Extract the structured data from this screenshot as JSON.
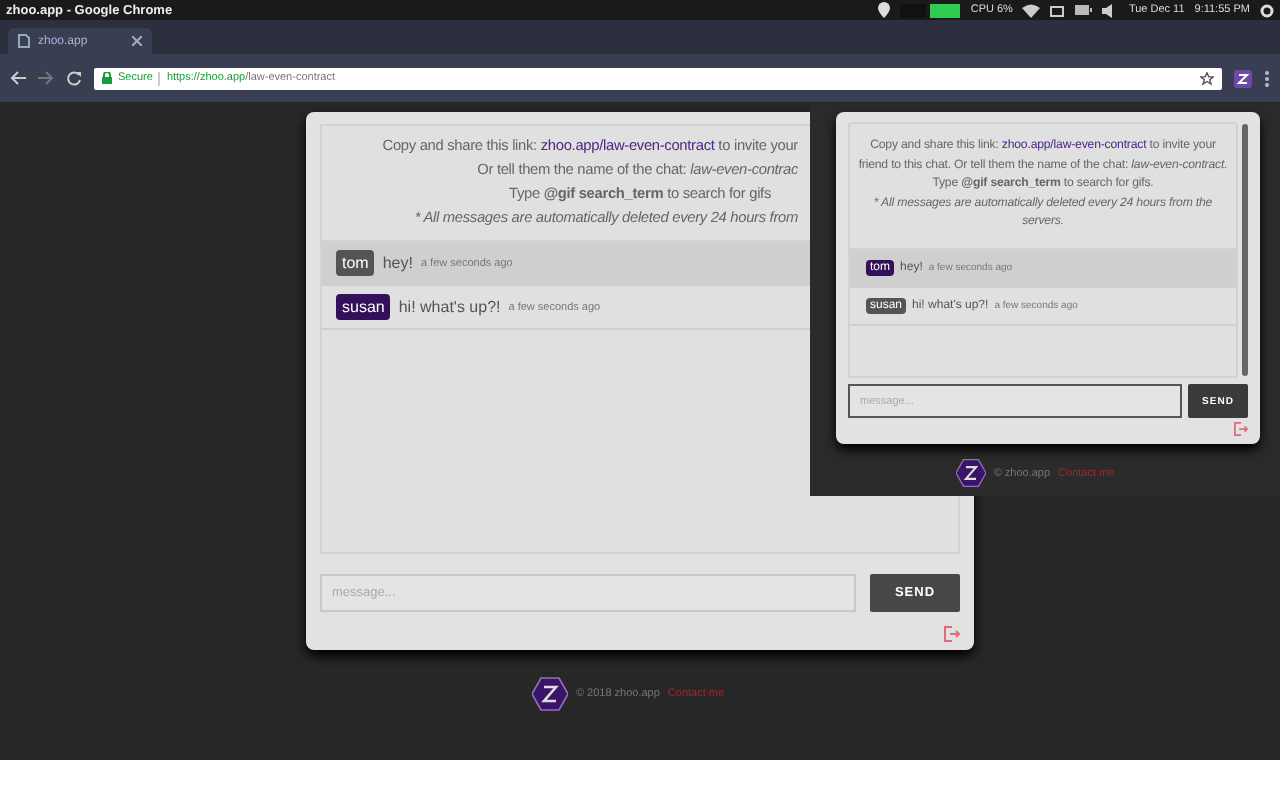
{
  "browser": {
    "window_title": "zhoo.app - Google Chrome",
    "tab_title": "zhoo.app",
    "secure_label": "Secure",
    "url_host": "https://zhoo.app",
    "url_path": "/law-even-contract"
  },
  "system_tray": {
    "cpu": "CPU 6%",
    "date": "Tue Dec 11",
    "time": "9:11:55 PM"
  },
  "chat": {
    "share_prefix": "Copy and share this link: ",
    "link": "zhoo.app/law-even-contract",
    "share_suffix": " to invite your",
    "chat_line": "Or tell them the name of the chat: *law-even-contrac*",
    "gif_line": "Type **@gif search_term** to search for gifs",
    "note": "* All messages are automatically deleted every 24 hours from",
    "messages": [
      {
        "user": "tom",
        "color": "#545454",
        "text": "hey!",
        "time": "a few seconds ago",
        "highlighted": true
      },
      {
        "user": "susan",
        "color": "#35105a",
        "text": "hi! what's up?!",
        "time": "a few seconds ago",
        "highlighted": false
      }
    ],
    "input": {
      "placeholder": "message..."
    },
    "send_button": "SEND"
  },
  "footer": {
    "copyright": "© 2018 zhoo.app",
    "contact": "Contact me"
  },
  "popup": {
    "share_prefix": "Copy and share this link: ",
    "link": "zhoo.app/law-even-contract",
    "share_suffix": " to invite your friend to this chat.",
    "chat_line": "Or tell them the name of the chat: *law-even-contract.*",
    "gif_line": "Type **@gif search_term** to search for gifs.",
    "note": "* All messages are automatically deleted every 24 hours from the servers.",
    "messages": [
      {
        "user": "tom",
        "color": "#35105a",
        "text": "hey!",
        "time": "a few seconds ago",
        "highlighted": true
      },
      {
        "user": "susan",
        "color": "#545454",
        "text": "hi! what's up?!",
        "time": "a few seconds ago",
        "highlighted": false
      }
    ],
    "input": {
      "placeholder": "message..."
    },
    "send_button": "SEND",
    "footer": {
      "copyright": "© zhoo.app",
      "contact": "Contact me"
    }
  }
}
